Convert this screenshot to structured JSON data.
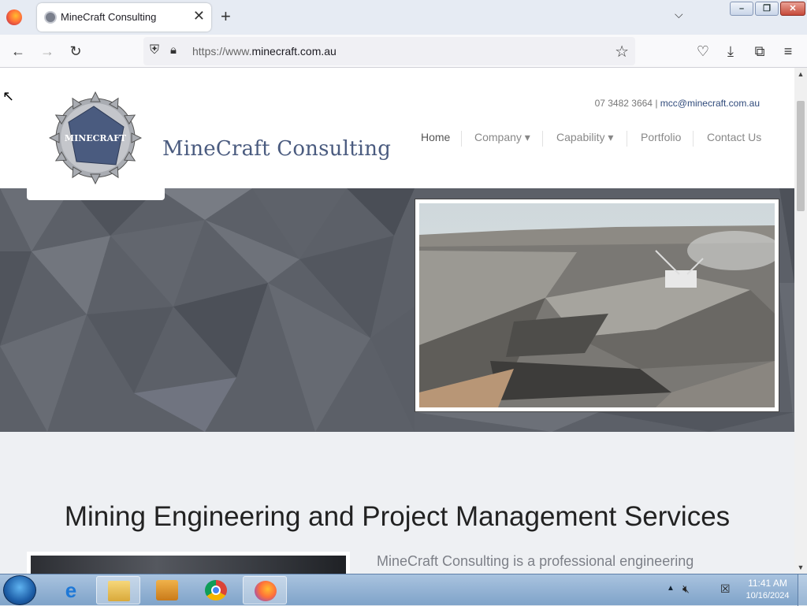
{
  "browser": {
    "tab_title": "MineCraft Consulting",
    "tab_close": "✕",
    "new_tab": "+",
    "url_prefix": "https://www.",
    "url_domain": "minecraft.com.au"
  },
  "site": {
    "logo_text": "MINECRAFT",
    "brand_name": "MineCraft Consulting",
    "phone": "07 3482 3664",
    "separator": " | ",
    "email": "mcc@minecraft.com.au",
    "nav": [
      {
        "label": "Home"
      },
      {
        "label": "Company ▾"
      },
      {
        "label": "Capability ▾"
      },
      {
        "label": "Portfolio"
      },
      {
        "label": "Contact Us"
      }
    ],
    "section_title": "Mining Engineering and Project Management Services",
    "intro": "MineCraft Consulting is a professional engineering"
  },
  "taskbar": {
    "time": "11:41 AM",
    "date": "10/16/2024"
  },
  "colors": {
    "brand": "#4a5b7f",
    "link": "#2f4a7b",
    "hero": "#5b5f66"
  }
}
